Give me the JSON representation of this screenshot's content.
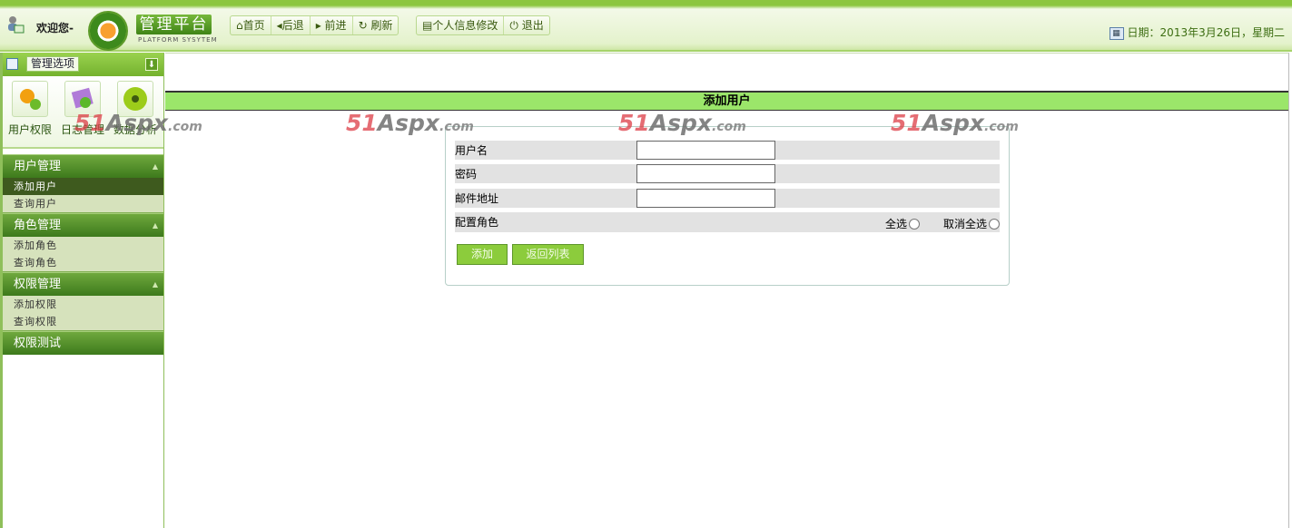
{
  "header": {
    "welcome": "欢迎您-",
    "brand": "管理平台",
    "brand_sub": "PLATFORM SYSYTEM",
    "nav": [
      {
        "icon": "home-icon",
        "glyph": "⌂",
        "label": "首页"
      },
      {
        "icon": "back-icon",
        "glyph": "◂",
        "label": "后退"
      },
      {
        "icon": "forward-icon",
        "glyph": "▸",
        "label": "前进"
      },
      {
        "icon": "refresh-icon",
        "glyph": "↻",
        "label": "刷新"
      }
    ],
    "nav2": [
      {
        "icon": "profile-icon",
        "glyph": "▤",
        "label": "个人信息修改"
      },
      {
        "icon": "power-icon",
        "glyph": "⏻",
        "label": "退出"
      }
    ],
    "date": "日期：2013年3月26日，星期二"
  },
  "sidebar": {
    "title": "管理选项",
    "quick": [
      {
        "label": "用户权限"
      },
      {
        "label": "日志管理"
      },
      {
        "label": "数据分析"
      }
    ],
    "groups": [
      {
        "label": "用户管理",
        "items": [
          "添加用户",
          "查询用户"
        ]
      },
      {
        "label": "角色管理",
        "items": [
          "添加角色",
          "查询角色"
        ]
      },
      {
        "label": "权限管理",
        "items": [
          "添加权限",
          "查询权限"
        ]
      },
      {
        "label": "权限测试"
      }
    ]
  },
  "main": {
    "title": "添加用户",
    "fields": [
      {
        "label": "用户名",
        "value": ""
      },
      {
        "label": "密码",
        "value": ""
      },
      {
        "label": "邮件地址",
        "value": ""
      }
    ],
    "roles_label": "配置角色",
    "select_all": "全选",
    "deselect_all": "取消全选",
    "add_button": "添加",
    "back_button": "返回列表"
  },
  "watermark": {
    "num": "51",
    "brand": "Aspx",
    "suffix": ".com"
  }
}
